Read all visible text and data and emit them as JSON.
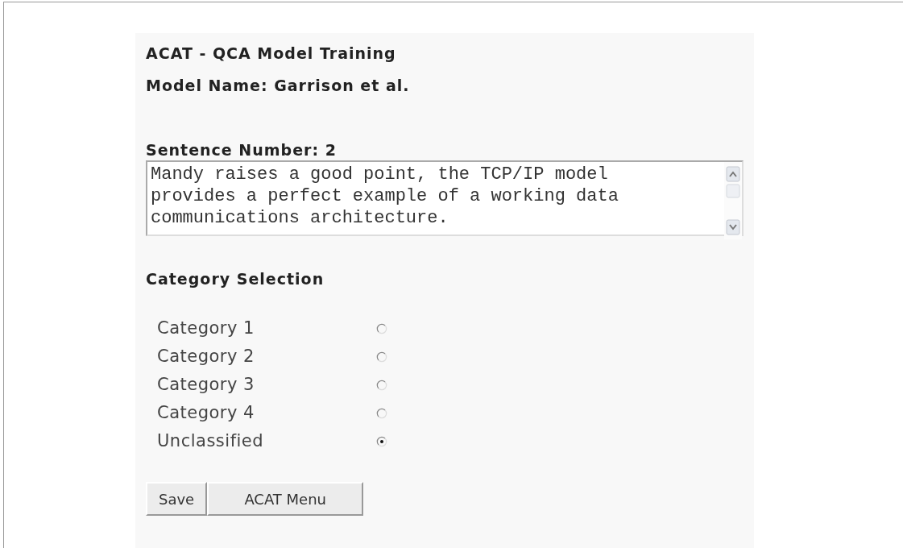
{
  "title": "ACAT - QCA Model Training",
  "model_name": "Model Name: Garrison et al.",
  "sentence_label": "Sentence Number: 2",
  "sentence_text": "Mandy raises a good point, the TCP/IP model provides a perfect example of a working data communications architecture.",
  "category_heading": "Category Selection",
  "categories": [
    {
      "label": "Category 1",
      "selected": false
    },
    {
      "label": "Category 2",
      "selected": false
    },
    {
      "label": "Category 3",
      "selected": false
    },
    {
      "label": "Category 4",
      "selected": false
    },
    {
      "label": "Unclassified",
      "selected": true
    }
  ],
  "buttons": [
    "Save",
    "ACAT Menu"
  ]
}
